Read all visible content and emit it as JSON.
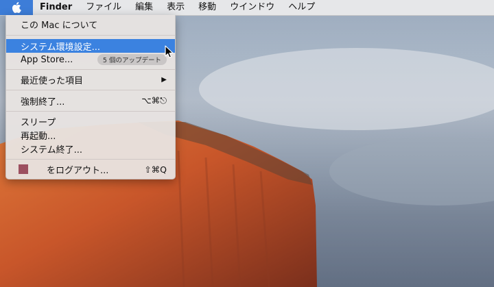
{
  "menubar": {
    "app_name": "Finder",
    "items": [
      "ファイル",
      "編集",
      "表示",
      "移動",
      "ウインドウ",
      "ヘルプ"
    ]
  },
  "apple_menu": {
    "about": "この Mac について",
    "system_prefs": "システム環境設定...",
    "app_store": "App Store...",
    "app_store_badge": "5 個のアップデート",
    "recent_items": "最近使った項目",
    "force_quit": "強制終了...",
    "force_quit_shortcut": "⌥⌘⎋",
    "sleep": "スリープ",
    "restart": "再起動...",
    "shutdown": "システム終了...",
    "logout": "をログアウト...",
    "logout_shortcut": "⇧⌘Q"
  },
  "colors": {
    "highlight": "#3b82e0",
    "apple_button": "#3d7dd8",
    "user_swatch": "#9c4f5f"
  }
}
